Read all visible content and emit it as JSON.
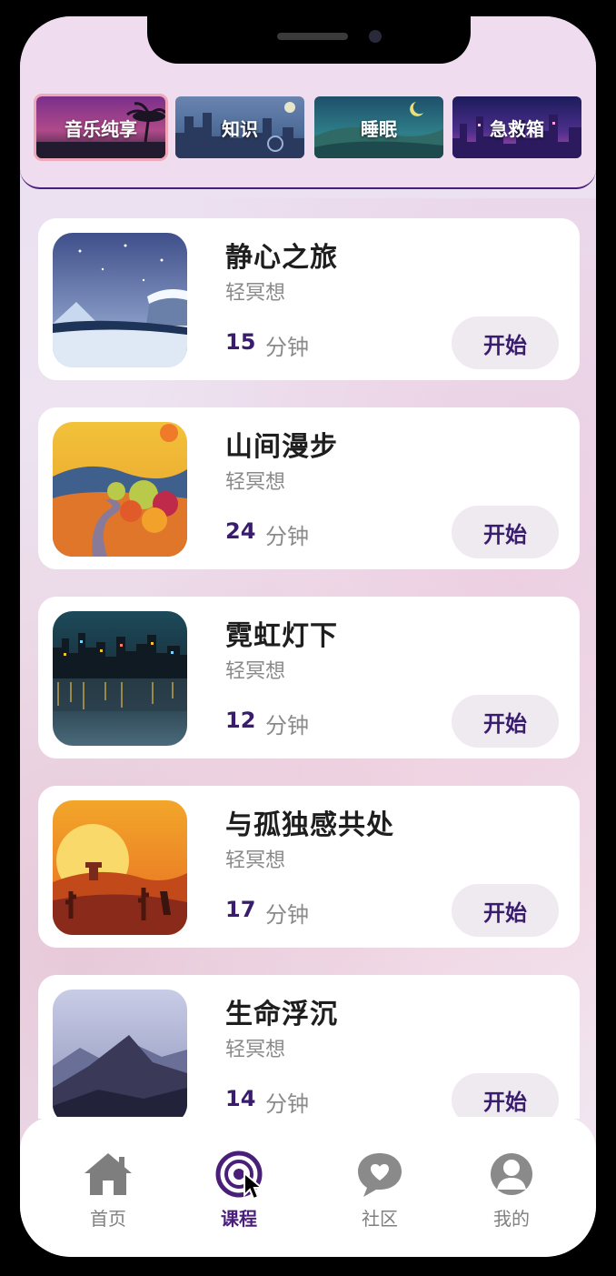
{
  "categories": [
    {
      "label": "音乐纯享",
      "active": true
    },
    {
      "label": "知识",
      "active": false
    },
    {
      "label": "睡眠",
      "active": false
    },
    {
      "label": "急救箱",
      "active": false
    }
  ],
  "courses": [
    {
      "title": "静心之旅",
      "subtitle": "轻冥想",
      "duration": "15",
      "unit": "分钟",
      "start_label": "开始",
      "thumb": "snowy-lake"
    },
    {
      "title": "山间漫步",
      "subtitle": "轻冥想",
      "duration": "24",
      "unit": "分钟",
      "start_label": "开始",
      "thumb": "autumn-road"
    },
    {
      "title": "霓虹灯下",
      "subtitle": "轻冥想",
      "duration": "12",
      "unit": "分钟",
      "start_label": "开始",
      "thumb": "night-city"
    },
    {
      "title": "与孤独感共处",
      "subtitle": "轻冥想",
      "duration": "17",
      "unit": "分钟",
      "start_label": "开始",
      "thumb": "desert-sunset"
    },
    {
      "title": "生命浮沉",
      "subtitle": "轻冥想",
      "duration": "14",
      "unit": "分钟",
      "start_label": "开始",
      "thumb": "misty-mountains"
    }
  ],
  "nav": [
    {
      "label": "首页",
      "icon": "home-icon",
      "active": false
    },
    {
      "label": "课程",
      "icon": "course-target-icon",
      "active": true
    },
    {
      "label": "社区",
      "icon": "community-chat-icon",
      "active": false
    },
    {
      "label": "我的",
      "icon": "profile-icon",
      "active": false
    }
  ],
  "colors": {
    "accent": "#4a1f7a",
    "inactive": "#808080",
    "card": "#ffffff",
    "start_bg": "#eeeaf0"
  }
}
